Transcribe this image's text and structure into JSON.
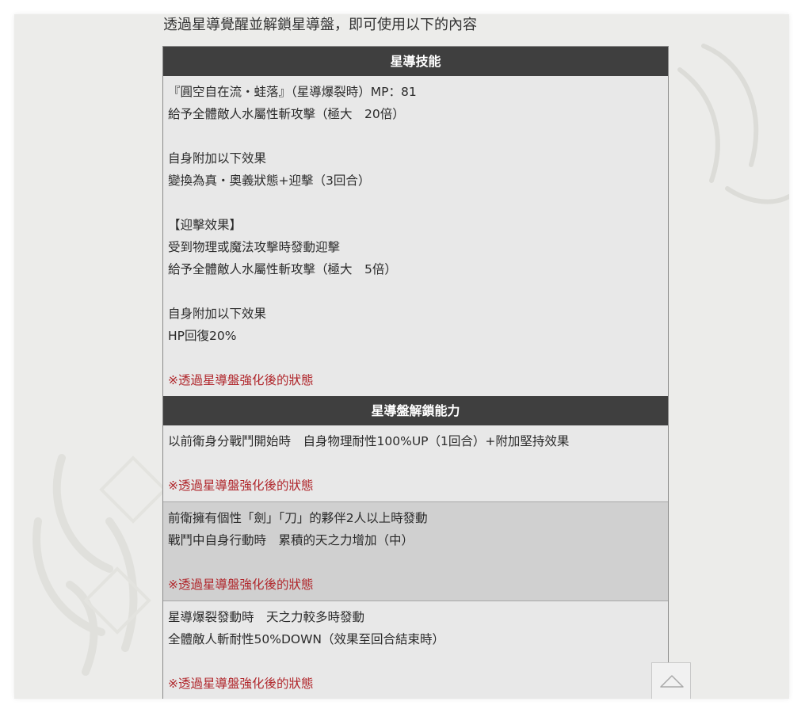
{
  "intro": "透過星導覺醒並解鎖星導盤，即可使用以下的內容",
  "skill": {
    "header": "星導技能",
    "lines": [
      "『圓空自在流・蛙落』（星導爆裂時）MP：81",
      "給予全體敵人水屬性斬攻擊（極大　20倍）",
      "",
      "自身附加以下效果",
      "變換為真・奧義狀態+迎擊（3回合）",
      "",
      "【迎擊效果】",
      "受到物理或魔法攻擊時發動迎擊",
      "給予全體敵人水屬性斬攻擊（極大　5倍）",
      "",
      "自身附加以下效果",
      "HP回復20%",
      ""
    ],
    "note": "※透過星導盤強化後的狀態"
  },
  "abilities": {
    "header": "星導盤解鎖能力",
    "rows": [
      {
        "lines": [
          "以前衛身分戰鬥開始時　自身物理耐性100%UP（1回合）+附加堅持效果",
          ""
        ],
        "note": "※透過星導盤強化後的狀態"
      },
      {
        "lines": [
          "前衛擁有個性「劍」「刀」的夥伴2人以上時發動",
          "戰鬥中自身行動時　累積的天之力增加（中）",
          ""
        ],
        "note": "※透過星導盤強化後的狀態"
      },
      {
        "lines": [
          "星導爆裂發動時　天之力較多時發動",
          "全體敵人斬耐性50%DOWN（效果至回合結束時）",
          ""
        ],
        "note": "※透過星導盤強化後的狀態"
      }
    ]
  },
  "back_to_top_icon": "triangle-up-icon",
  "colors": {
    "header_bg": "#3f3f3f",
    "note_red": "#b0262b",
    "cell_bg": "#e8e8e8",
    "cell_grey": "#d0d0d0"
  }
}
